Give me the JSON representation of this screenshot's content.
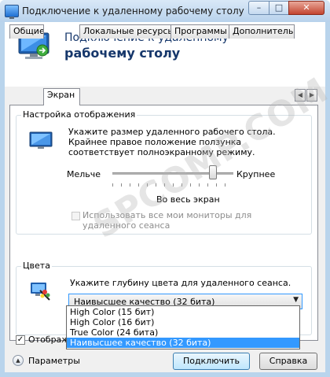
{
  "window": {
    "title": "Подключение к удаленному рабочему столу",
    "buttons": {
      "minimize": "–",
      "maximize": "□",
      "close": "✕"
    }
  },
  "banner": {
    "line1": "Подключение к удаленному",
    "line2": "рабочему столу"
  },
  "tabs": [
    {
      "label": "Общие",
      "active": false
    },
    {
      "label": "Экран",
      "active": true
    },
    {
      "label": "Локальные ресурсы",
      "active": false
    },
    {
      "label": "Программы",
      "active": false
    },
    {
      "label": "Дополнительно",
      "active": false
    }
  ],
  "tab_scroll": {
    "left": "◀",
    "right": "▶"
  },
  "display": {
    "group_title": "Настройка отображения",
    "description": "Укажите размер удаленного рабочего стола. Крайнее правое положение ползунка соответствует полноэкранному режиму.",
    "slider_min_label": "Мельче",
    "slider_max_label": "Крупнее",
    "slider_value": 1.0,
    "current_size": "Во весь экран",
    "multimon_label": "Использовать все мои мониторы для удаленного сеанса",
    "multimon_checked": false,
    "multimon_enabled": false
  },
  "colors": {
    "group_title": "Цвета",
    "description": "Укажите глубину цвета для удаленного сеанса.",
    "selected": "Наивысшее качество (32 бита)",
    "dropdown_arrow": "▼",
    "options": [
      "High Color (15 бит)",
      "High Color (16 бит)",
      "True Color (24 бита)",
      "Наивысшее качество (32 бита)"
    ],
    "highlighted_index": 3
  },
  "show_bar": {
    "label": "Отображать",
    "checked": true,
    "check_mark": "✓"
  },
  "bottom": {
    "params_label": "Параметры",
    "params_icon": "▲",
    "connect_label": "Подключить",
    "help_label": "Справка"
  },
  "watermark": "SPCOMP.COM",
  "colors_theme": {
    "accent": "#3399ff",
    "title_text": "#16376b",
    "frame": "#b9d4ec"
  }
}
